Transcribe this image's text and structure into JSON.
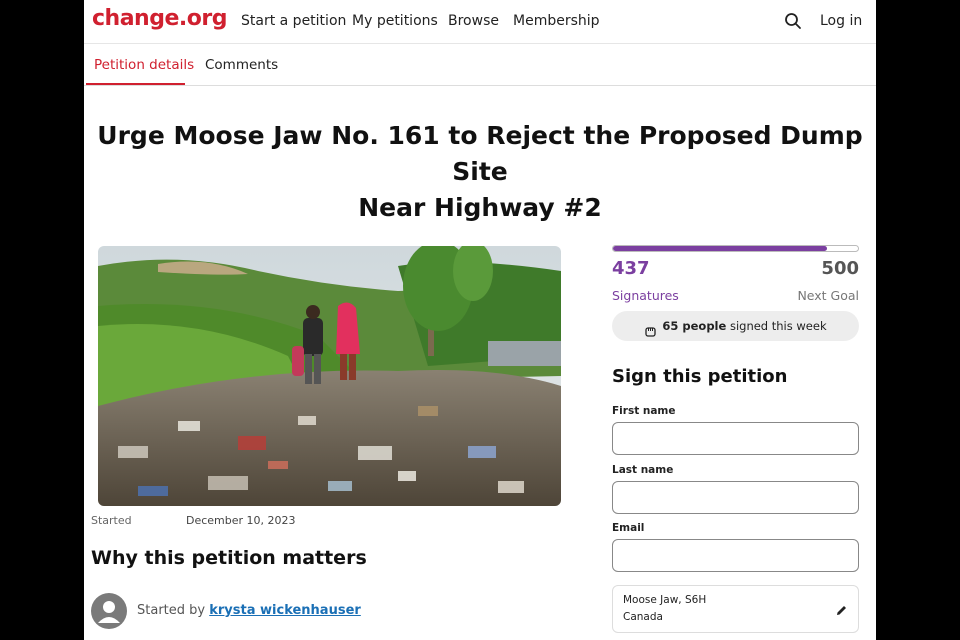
{
  "header": {
    "logo": "change.org",
    "nav": [
      "Start a petition",
      "My petitions",
      "Browse",
      "Membership"
    ],
    "login": "Log in",
    "search_icon": "search-icon"
  },
  "tabs": [
    {
      "label": "Petition details",
      "active": true
    },
    {
      "label": "Comments",
      "active": false
    }
  ],
  "petition": {
    "title_line1": "Urge Moose Jaw No. 161 to Reject the Proposed Dump Site",
    "title_line2": "Near Highway #2",
    "image": "photo of children standing on a pile of garbage at a dump site with green hills",
    "started_label": "Started",
    "started_date": "December 10, 2023",
    "why_heading": "Why this petition matters",
    "started_by_prefix": "Started by",
    "author": "krysta wickenhauser"
  },
  "signatures": {
    "count": "437",
    "count_label": "Signatures",
    "goal": "500",
    "goal_label": "Next Goal",
    "progress_fraction": 0.874,
    "week_count": "65 people",
    "week_suffix": "signed this week",
    "accent_color": "#7b3fa0"
  },
  "form": {
    "heading": "Sign this petition",
    "first_name_label": "First name",
    "first_name_value": "",
    "last_name_label": "Last name",
    "last_name_value": "",
    "email_label": "Email",
    "email_value": "",
    "location_line1": "Moose Jaw, S6H",
    "location_line2": "Canada",
    "edit_icon": "pencil-icon"
  },
  "colors": {
    "brand": "#d0202f",
    "link": "#1a6fb5"
  }
}
